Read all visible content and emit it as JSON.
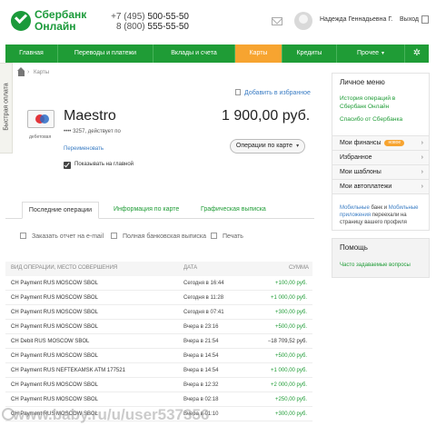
{
  "brand": {
    "line1": "Сбербанк",
    "line2": "Онлайн"
  },
  "header": {
    "phone1_prefix": "+7 (495)",
    "phone1": "500-55-50",
    "phone2_prefix": "8 (800)",
    "phone2": "555-55-50",
    "username": "Надежда Геннадьевна Г.",
    "logout": "Выход"
  },
  "nav": {
    "items": [
      {
        "label": "Главная"
      },
      {
        "label": "Переводы и платежи"
      },
      {
        "label": "Вклады и счета"
      },
      {
        "label": "Карты"
      },
      {
        "label": "Кредиты"
      },
      {
        "label": "Прочее"
      }
    ],
    "active": "Карты"
  },
  "sidebar_tab": "Быстрая оплата",
  "breadcrumb": {
    "separator": "›",
    "current": "Карты"
  },
  "favorite_link": "Добавить в избранное",
  "card": {
    "type": "дебетовая",
    "name": "Maestro",
    "number": "•••• 3257, действует по",
    "balance": "1 900,00 руб.",
    "operations_button": "Операции по карте",
    "rename_link": "Переименовать",
    "show_on_main": "Показывать на главной",
    "show_on_main_checked": true
  },
  "tabs": [
    "Последние операции",
    "Информация по карте",
    "Графическая выписка"
  ],
  "actions": {
    "email": "Заказать отчет на e-mail",
    "statement": "Полная банковская выписка",
    "print": "Печать"
  },
  "table": {
    "headers": {
      "operation": "ВИД ОПЕРАЦИИ, МЕСТО СОВЕРШЕНИЯ",
      "date": "ДАТА",
      "amount": "СУММА"
    },
    "rows": [
      {
        "op": "CH Payment RUS MOSCOW SBOL",
        "date": "Сегодня в 16:44",
        "amount": "+100,00 руб."
      },
      {
        "op": "CH Payment RUS MOSCOW SBOL",
        "date": "Сегодня в 11:28",
        "amount": "+1 000,00 руб."
      },
      {
        "op": "CH Payment RUS MOSCOW SBOL",
        "date": "Сегодня в 07:41",
        "amount": "+300,00 руб."
      },
      {
        "op": "CH Payment RUS MOSCOW SBOL",
        "date": "Вчера в 23:16",
        "amount": "+500,00 руб."
      },
      {
        "op": "CH Debit RUS MOSCOW SBOL",
        "date": "Вчера в 21:54",
        "amount": "−18 709,52 руб."
      },
      {
        "op": "CH Payment RUS MOSCOW SBOL",
        "date": "Вчера в 14:54",
        "amount": "+500,00 руб."
      },
      {
        "op": "CH Payment RUS NEFTEKAMSK ATM 177521",
        "date": "Вчера в 14:54",
        "amount": "+1 000,00 руб."
      },
      {
        "op": "CH Payment RUS MOSCOW SBOL",
        "date": "Вчера в 12:32",
        "amount": "+2 000,00 руб."
      },
      {
        "op": "CH Payment RUS MOSCOW SBOL",
        "date": "Вчера в 02:18",
        "amount": "+250,00 руб."
      },
      {
        "op": "CH Payment RUS MOSCOW SBOL",
        "date": "Вчера в 01:10",
        "amount": "+300,00 руб."
      }
    ]
  },
  "right_panel": {
    "title": "Личное меню",
    "links": [
      "История операций в Сбербанк Онлайн",
      "Спасибо от Сбербанка"
    ],
    "menu": [
      {
        "label": "Мои финансы",
        "badge": "новое"
      },
      {
        "label": "Избранное"
      },
      {
        "label": "Мои шаблоны"
      },
      {
        "label": "Мои автоплатежи"
      }
    ],
    "mobile": {
      "link1": "Мобильные",
      "text1": "банк и",
      "link2": "Мобильные приложения",
      "text2": "переехали на страницу вашего профиля"
    }
  },
  "help": {
    "title": "Помощь",
    "link": "Часто задаваемые вопросы"
  },
  "watermark": "www.baby.ru/u/user537356",
  "colors": {
    "accent_green": "#1f9c36",
    "active_orange": "#f7a430",
    "link_blue": "#3b7dc4"
  }
}
